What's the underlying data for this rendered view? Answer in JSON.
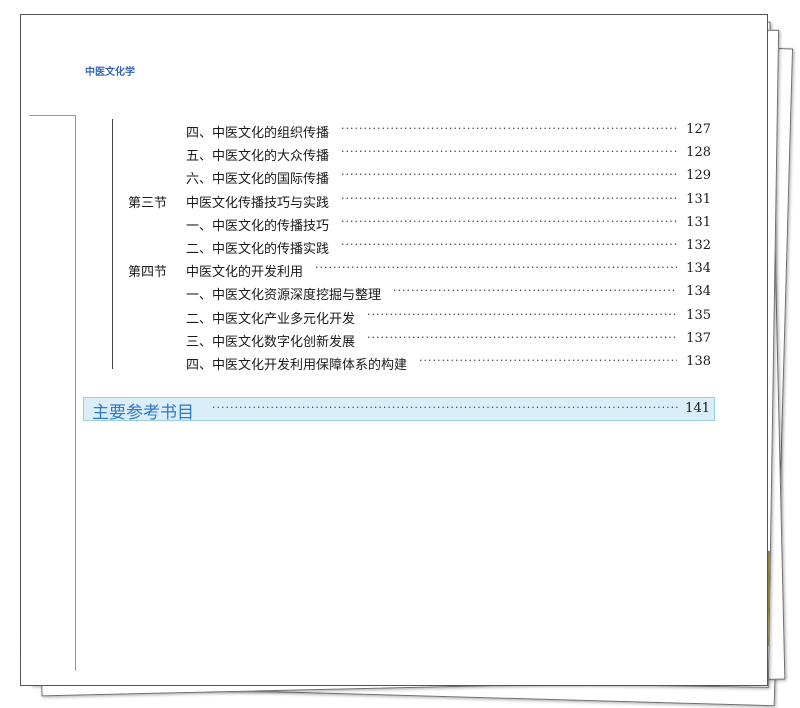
{
  "header": {
    "running_head": "中医文化学"
  },
  "toc": [
    {
      "section": "",
      "title": "四、中医文化的组织传播",
      "page": "127",
      "indent": true
    },
    {
      "section": "",
      "title": "五、中医文化的大众传播",
      "page": "128",
      "indent": true
    },
    {
      "section": "",
      "title": "六、中医文化的国际传播",
      "page": "129",
      "indent": true
    },
    {
      "section": "第三节",
      "title": "中医文化传播技巧与实践",
      "page": "131",
      "indent": false
    },
    {
      "section": "",
      "title": "一、中医文化的传播技巧",
      "page": "131",
      "indent": true
    },
    {
      "section": "",
      "title": "二、中医文化的传播实践",
      "page": "132",
      "indent": true
    },
    {
      "section": "第四节",
      "title": "中医文化的开发利用",
      "page": "134",
      "indent": false
    },
    {
      "section": "",
      "title": "一、中医文化资源深度挖掘与整理",
      "page": "134",
      "indent": true
    },
    {
      "section": "",
      "title": "二、中医文化产业多元化开发",
      "page": "135",
      "indent": true
    },
    {
      "section": "",
      "title": "三、中医文化数字化创新发展",
      "page": "137",
      "indent": true
    },
    {
      "section": "",
      "title": "四、中医文化开发利用保障体系的构建",
      "page": "138",
      "indent": true
    }
  ],
  "references": {
    "title": "主要参考书目",
    "page": "141"
  }
}
